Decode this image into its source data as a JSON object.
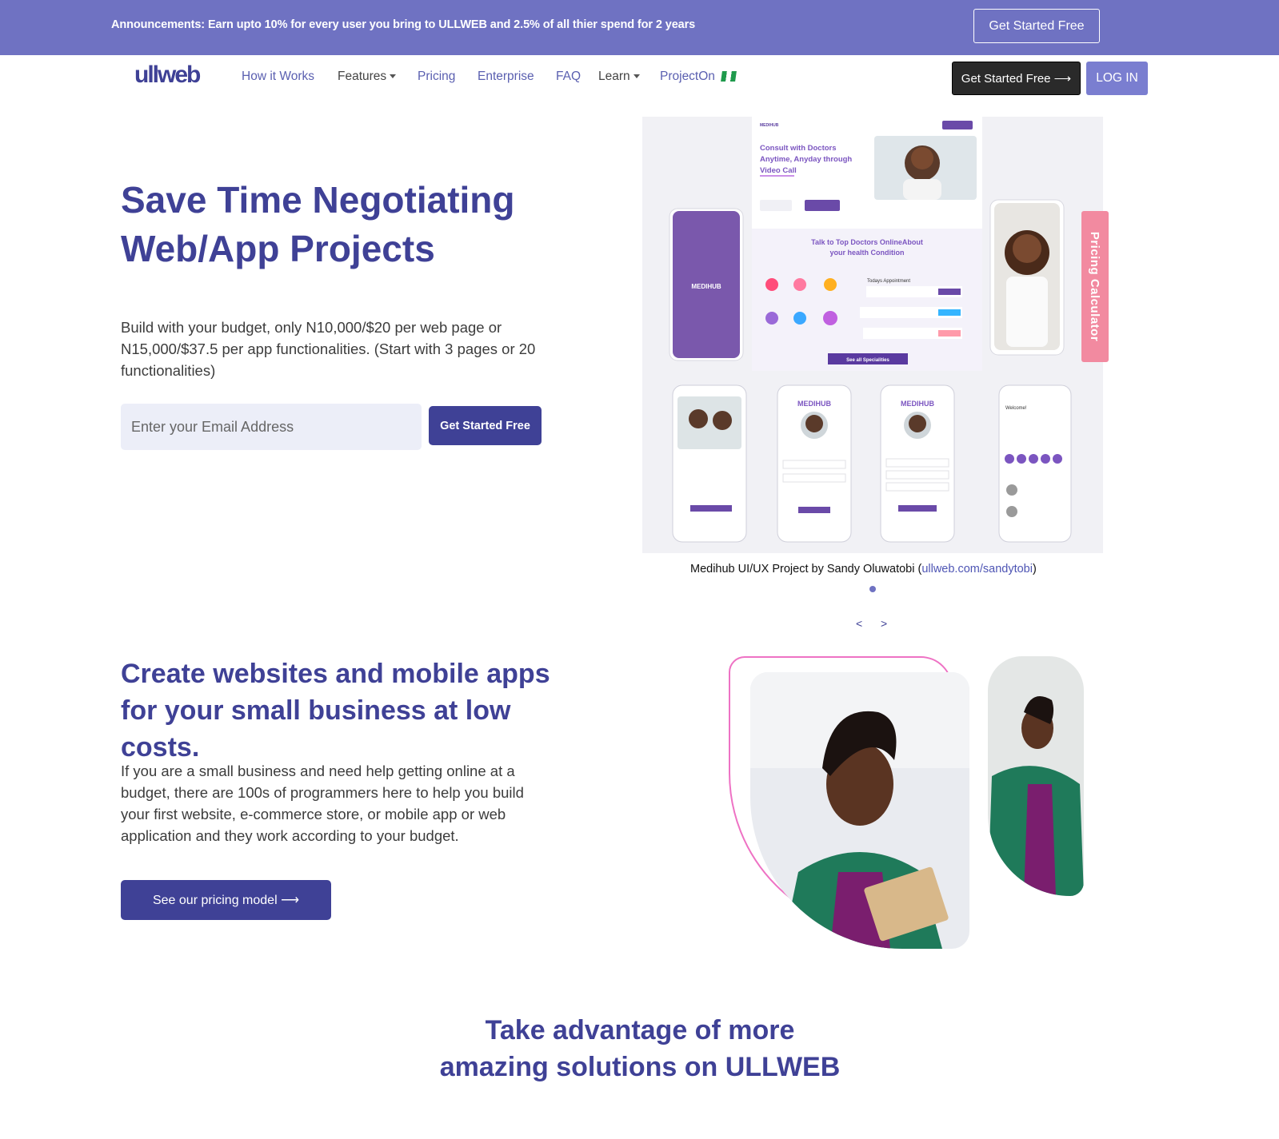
{
  "announcement": {
    "text": "Announcements: Earn upto 10% for every user you bring to ULLWEB and 2.5% of all thier spend for 2 years",
    "cta_label": "Get Started Free"
  },
  "navbar": {
    "logo_text": "ullweb",
    "items": [
      {
        "label": "How it Works"
      },
      {
        "label": "Features"
      },
      {
        "label": "Pricing"
      },
      {
        "label": "Enterprise"
      },
      {
        "label": "FAQ"
      },
      {
        "label": "Learn"
      },
      {
        "label": "ProjectOn"
      }
    ],
    "cta_label": "Get Started Free ⟶",
    "login_label": "LOG IN"
  },
  "hero": {
    "title_line1": "Save Time Negotiating",
    "title_line2": "Web/App Projects",
    "description": "Build with your budget, only N10,000/$20 per web page or N15,000/$37.5 per app functionalities. (Start with 3 pages or 20 functionalities)",
    "email_placeholder": "Enter your Email Address",
    "cta_label": "Get Started Free"
  },
  "showcase": {
    "side_tab_label": "Pricing Calculator",
    "caption_prefix": "Medihub UI/UX Project by Sandy Oluwatobi (",
    "caption_link": "ullweb.com/sandytobi",
    "caption_suffix": ")",
    "prev_label": "<",
    "next_label": ">",
    "mock": {
      "brand": "MEDIHUB",
      "headline_line1": "Consult with Doctors",
      "headline_line2": "Anytime, Anyday through",
      "headline_line3": "Video Call",
      "section_title_line1": "Talk to Top Doctors OnlineAbout",
      "section_title_line2": "your health Condition",
      "see_all": "See all Specialities",
      "appointments": "Todays Appointment",
      "phone_brand": "MEDIHUB",
      "welcome": "Welcome!"
    }
  },
  "section2": {
    "title_line1": "Create websites and mobile apps",
    "title_line2": "for your small business at low",
    "title_line3": "costs.",
    "description": "If you are a small business and need help getting online at a budget, there are 100s of programmers here to help you build your first website, e-commerce store, or mobile app or web application and they work according to your budget.",
    "cta_label": "See our pricing model ⟶"
  },
  "section3": {
    "title_line1": "Take advantage of more",
    "title_line2": "amazing solutions on ULLWEB"
  },
  "colors": {
    "brand_purple": "#3f4196",
    "announce_bg": "#6f72c2",
    "pricing_tab": "#f28aa0",
    "accent_pink": "#ee72c4"
  }
}
